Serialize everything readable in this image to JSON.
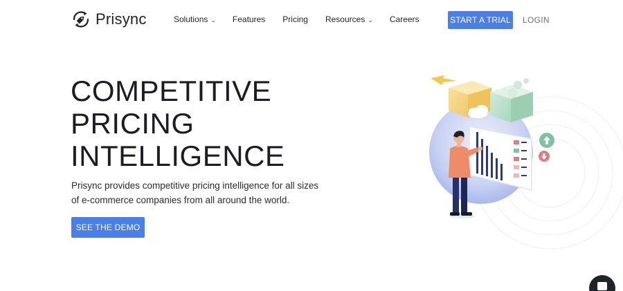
{
  "brand": {
    "name": "Prisync"
  },
  "nav": {
    "items": [
      {
        "label": "Solutions",
        "has_dropdown": true
      },
      {
        "label": "Features",
        "has_dropdown": false
      },
      {
        "label": "Pricing",
        "has_dropdown": false
      },
      {
        "label": "Resources",
        "has_dropdown": true
      },
      {
        "label": "Careers",
        "has_dropdown": false
      }
    ],
    "dropdown_glyph": "⌄"
  },
  "header": {
    "trial_button": "START A TRIAL",
    "login_link": "LOGIN"
  },
  "hero": {
    "headline_lines": [
      "COMPETITIVE",
      "PRICING",
      "INTELLIGENCE"
    ],
    "description": "Prisync provides competitive pricing intelligence for all sizes of e-commerce companies from all around the world.",
    "cta_button": "SEE THE DEMO"
  },
  "colors": {
    "primary": "#4a7ee8",
    "text_dark": "#1c1c24",
    "login_gray": "#6b6f78",
    "illustration_blue": "#a9b8ec",
    "accent_green": "#7cc3a3",
    "accent_red": "#e27a7f",
    "accent_yellow": "#f4d27a",
    "chat_widget": "#1f2226"
  },
  "icons": {
    "logo": "price-tag-cycle-icon",
    "chat": "chat-bubble-icon",
    "arrow_up": "arrow-up-icon",
    "arrow_down": "arrow-down-icon"
  }
}
